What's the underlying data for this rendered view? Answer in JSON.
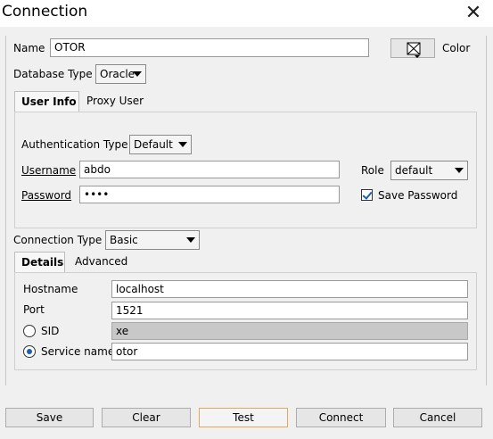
{
  "window": {
    "title": "Connection"
  },
  "name": {
    "label": "Name",
    "value": "OTOR",
    "color_label": "Color"
  },
  "database_type": {
    "label": "Database Type",
    "value": "Oracle"
  },
  "tabs_top": [
    {
      "label": "User Info"
    },
    {
      "label": "Proxy User"
    }
  ],
  "user_info": {
    "auth_label": "Authentication Type",
    "auth_value": "Default",
    "username_label": "Username",
    "username_value": "abdo",
    "password_label": "Password",
    "password_value": "••••",
    "role_label": "Role",
    "role_value": "default",
    "save_password_label": "Save Password",
    "save_password_checked": true
  },
  "connection_type": {
    "label": "Connection Type",
    "value": "Basic"
  },
  "tabs_bottom": [
    {
      "label": "Details"
    },
    {
      "label": "Advanced"
    }
  ],
  "details": {
    "hostname_label": "Hostname",
    "hostname_value": "localhost",
    "port_label": "Port",
    "port_value": "1521",
    "sid_label": "SID",
    "sid_value": "xe",
    "service_label": "Service name",
    "service_value": "otor",
    "selected": "service_name"
  },
  "buttons": {
    "save": "Save",
    "clear": "Clear",
    "test": "Test",
    "connect": "Connect",
    "cancel": "Cancel"
  }
}
